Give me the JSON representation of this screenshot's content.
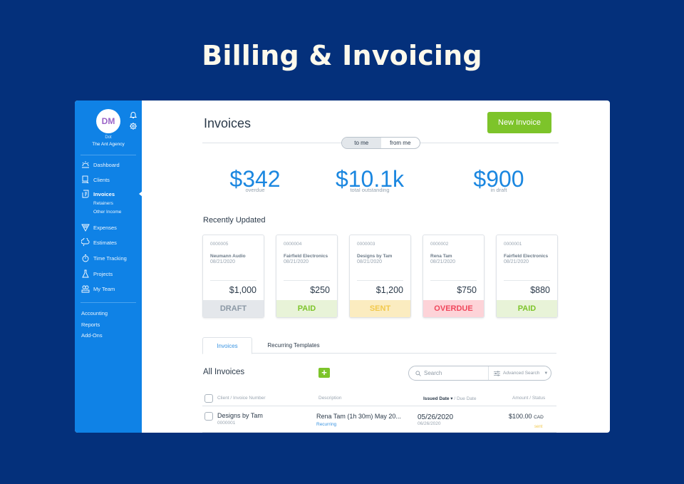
{
  "hero": {
    "title": "Billing & Invoicing"
  },
  "sidebar": {
    "avatar_initials": "DM",
    "user_name": "Dot",
    "org_name": "The Ant Agency",
    "items": [
      {
        "label": "Dashboard",
        "icon": "dashboard-icon"
      },
      {
        "label": "Clients",
        "icon": "clients-icon"
      },
      {
        "label": "Invoices",
        "icon": "invoices-icon",
        "active": true
      },
      {
        "label": "Expenses",
        "icon": "expenses-icon"
      },
      {
        "label": "Estimates",
        "icon": "estimates-icon"
      },
      {
        "label": "Time Tracking",
        "icon": "stopwatch-icon"
      },
      {
        "label": "Projects",
        "icon": "flask-icon"
      },
      {
        "label": "My Team",
        "icon": "team-icon"
      }
    ],
    "sub_items": [
      "Retainers",
      "Other Income"
    ],
    "extra_items": [
      "Accounting",
      "Reports",
      "Add-Ons"
    ]
  },
  "header": {
    "title": "Invoices",
    "new_invoice_label": "New Invoice",
    "toggle": {
      "options": [
        "to me",
        "from me"
      ],
      "selected": "to me"
    }
  },
  "stats": [
    {
      "value": "$342",
      "label": "overdue"
    },
    {
      "value": "$10.1k",
      "label": "total outstanding"
    },
    {
      "value": "$900",
      "label": "in draft"
    }
  ],
  "recent": {
    "title": "Recently Updated",
    "cards": [
      {
        "number": "0000005",
        "client": "Neumann Audio",
        "date": "08/21/2020",
        "amount": "$1,000",
        "status": "DRAFT",
        "status_color": "#8b98a5",
        "status_bg": "#e4e7eb"
      },
      {
        "number": "0000004",
        "client": "Fairfield Electronics",
        "date": "08/21/2020",
        "amount": "$250",
        "status": "PAID",
        "status_color": "#7dc42a",
        "status_bg": "#e8f3d8"
      },
      {
        "number": "0000003",
        "client": "Designs by Tam",
        "date": "08/21/2020",
        "amount": "$1,200",
        "status": "SENT",
        "status_color": "#f2c94c",
        "status_bg": "#fbecc0"
      },
      {
        "number": "0000002",
        "client": "Rena Tam",
        "date": "08/21/2020",
        "amount": "$750",
        "status": "OVERDUE",
        "status_color": "#f0475c",
        "status_bg": "#fdd3d8"
      },
      {
        "number": "0000001",
        "client": "Fairfield Electronics",
        "date": "08/21/2020",
        "amount": "$880",
        "status": "PAID",
        "status_color": "#7dc42a",
        "status_bg": "#e8f3d8"
      }
    ]
  },
  "tabs": [
    {
      "label": "Invoices",
      "active": true
    },
    {
      "label": "Recurring Templates",
      "active": false
    }
  ],
  "list": {
    "title": "All Invoices",
    "add_label": "+",
    "search_placeholder": "Search",
    "advanced_search_label": "Advanced Search",
    "columns": {
      "client": "Client / Invoice Number",
      "description": "Description",
      "issued": "Issued Date ▾",
      "due": " / Due Date",
      "amount": "Amount / Status"
    },
    "rows": [
      {
        "client": "Designs by Tam",
        "number": "0000001",
        "description": "Rena Tam (1h 30m) May 20...",
        "tag": "Recurring",
        "issued": "05/26/2020",
        "due": "06/26/2020",
        "amount": "$100.00",
        "currency": "CAD",
        "status": "sent"
      }
    ]
  },
  "colors": {
    "brand_blue": "#0f82e6",
    "accent_green": "#7dc42a",
    "page_bg": "#04307b"
  }
}
